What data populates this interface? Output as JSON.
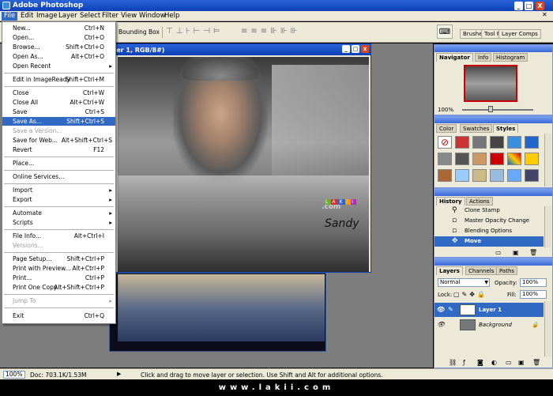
{
  "app": {
    "title": "Adobe Photoshop",
    "window_buttons": [
      "_",
      "□",
      "X"
    ]
  },
  "menubar": {
    "items": [
      "File",
      "Edit",
      "Image",
      "Layer",
      "Select",
      "Filter",
      "View",
      "Window",
      "Help"
    ]
  },
  "options": {
    "bounding_box": "Bounding Box",
    "tabs": [
      "Brushe",
      "Tool P",
      "Layer Comps"
    ]
  },
  "file_menu": {
    "items": [
      {
        "label": "New...",
        "shortcut": "Ctrl+N"
      },
      {
        "label": "Open...",
        "shortcut": "Ctrl+O"
      },
      {
        "label": "Browse...",
        "shortcut": "Shift+Ctrl+O"
      },
      {
        "label": "Open As...",
        "shortcut": "Alt+Ctrl+O"
      },
      {
        "label": "Open Recent",
        "shortcut": ""
      },
      {
        "label": "Edit in ImageReady",
        "shortcut": "Shift+Ctrl+M"
      },
      {
        "label": "Close",
        "shortcut": "Ctrl+W"
      },
      {
        "label": "Close All",
        "shortcut": "Alt+Ctrl+W"
      },
      {
        "label": "Save",
        "shortcut": "Ctrl+S"
      },
      {
        "label": "Save As...",
        "shortcut": "Shift+Ctrl+S"
      },
      {
        "label": "Save a Version...",
        "shortcut": ""
      },
      {
        "label": "Save for Web...",
        "shortcut": "Alt+Shift+Ctrl+S"
      },
      {
        "label": "Revert",
        "shortcut": "F12"
      },
      {
        "label": "Place...",
        "shortcut": ""
      },
      {
        "label": "Online Services...",
        "shortcut": ""
      },
      {
        "label": "Import",
        "shortcut": ""
      },
      {
        "label": "Export",
        "shortcut": ""
      },
      {
        "label": "Automate",
        "shortcut": ""
      },
      {
        "label": "Scripts",
        "shortcut": ""
      },
      {
        "label": "File Info...",
        "shortcut": "Alt+Ctrl+I"
      },
      {
        "label": "Versions...",
        "shortcut": ""
      },
      {
        "label": "Page Setup...",
        "shortcut": "Shift+Ctrl+P"
      },
      {
        "label": "Print with Preview...",
        "shortcut": "Alt+Ctrl+P"
      },
      {
        "label": "Print...",
        "shortcut": "Ctrl+P"
      },
      {
        "label": "Print One Copy",
        "shortcut": "Alt+Shift+Ctrl+P"
      },
      {
        "label": "Jump To",
        "shortcut": ""
      },
      {
        "label": "Exit",
        "shortcut": "Ctrl+Q"
      }
    ]
  },
  "document": {
    "title": "yer 1, RGB/8#)",
    "watermark_text": ".com",
    "signature": "Sandy"
  },
  "navigator": {
    "tabs": [
      "Navigator",
      "Info",
      "Histogram"
    ],
    "zoom": "100%"
  },
  "color_panel": {
    "tabs": [
      "Color",
      "Swatches",
      "Styles"
    ]
  },
  "history": {
    "tabs": [
      "History",
      "Actions"
    ],
    "items": [
      "Clone Stamp",
      "Master Opacity Change",
      "Blending Options",
      "Move"
    ]
  },
  "layers": {
    "tabs": [
      "Layers",
      "Channels",
      "Paths"
    ],
    "blend_mode": "Normal",
    "opacity_label": "Opacity:",
    "opacity": "100%",
    "lock_label": "Lock:",
    "fill_label": "Fill:",
    "fill": "100%",
    "items": [
      "Layer 1",
      "Background"
    ]
  },
  "status": {
    "zoom": "100%",
    "doc": "Doc: 703.1K/1.53M",
    "hint": "Click and drag to move layer or selection.  Use Shift and Alt for additional options."
  },
  "footer": {
    "text": "www.lakii.com"
  },
  "colors": {
    "accent": "#316ac5",
    "titlebar": "#0a3fb8",
    "panel_bg": "#ece9d8"
  }
}
